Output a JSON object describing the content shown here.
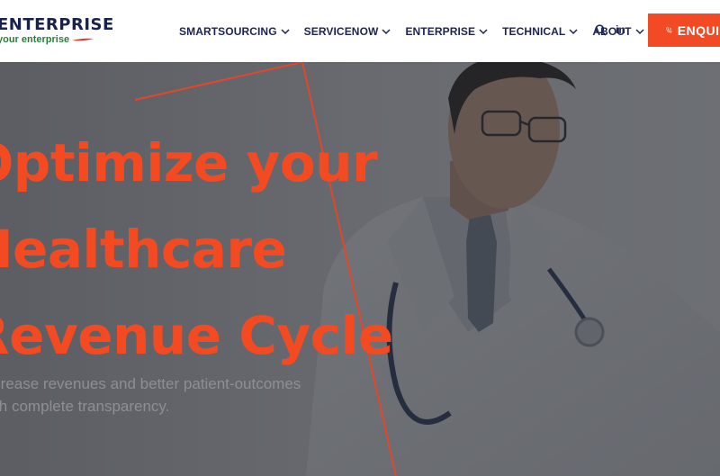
{
  "header": {
    "logo_main": "ENTERPRISE",
    "logo_tagline": "your enterprise",
    "nav": [
      {
        "label": "SMARTSOURCING"
      },
      {
        "label": "SERVICENOW"
      },
      {
        "label": "ENTERPRISE"
      },
      {
        "label": "TECHNICAL"
      },
      {
        "label": "ABOUT"
      }
    ],
    "linkedin_label": "in",
    "enquire_label": "ENQUIRE"
  },
  "hero": {
    "title_lines": [
      "Optimize your",
      "Healthcare",
      "Revenue Cycle"
    ],
    "subtitle_lines": [
      "Increase revenues and better patient-outcomes",
      "with complete transparency."
    ]
  },
  "colors": {
    "accent": "#f24a25",
    "nav_text": "#1c2452",
    "logo_green": "#2a7e3a"
  },
  "icons": [
    "chevron-down-icon",
    "search-icon",
    "linkedin-icon",
    "phone-icon",
    "logo-swoosh-icon"
  ]
}
